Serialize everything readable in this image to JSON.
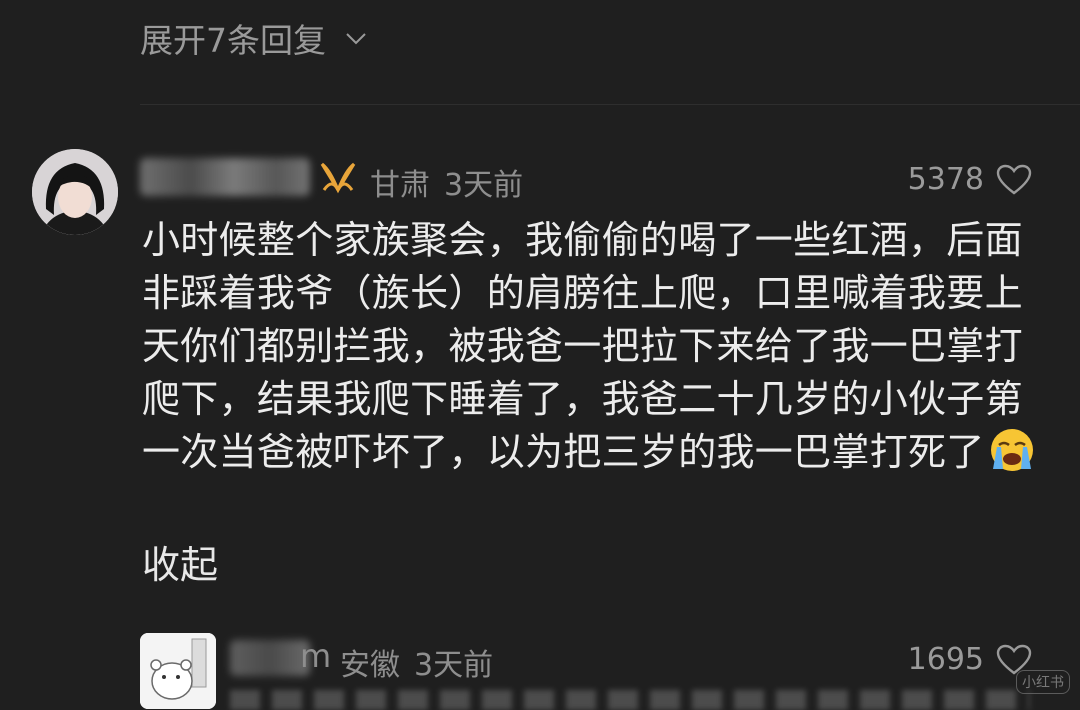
{
  "expand_replies": {
    "label": "展开7条回复"
  },
  "comment": {
    "location": "甘肃",
    "time": "3天前",
    "likes": "5378",
    "text": "小时候整个家族聚会，我偷偷的喝了一些红酒，后面非踩着我爷（族长）的肩膀往上爬，口里喊着我要上天你们都别拦我，被我爸一把拉下来给了我一巴掌打爬下，结果我爬下睡着了，我爸二十几岁的小伙子第一次当爸被吓坏了，以为把三岁的我一巴掌打死了",
    "emoji": "loudly-crying-face",
    "collapse_label": "收起"
  },
  "next_comment": {
    "username_tail": "m",
    "location": "安徽",
    "time": "3天前",
    "likes": "1695"
  },
  "watermark": "小红书",
  "colors": {
    "background": "#1f1f1f",
    "text": "#ececec",
    "meta": "#8e8e8e",
    "badge": "#e8a53a"
  }
}
